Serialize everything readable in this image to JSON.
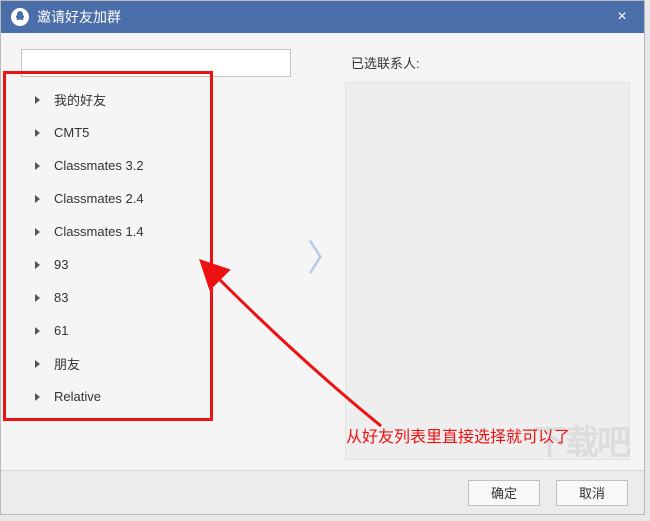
{
  "title": "邀请好友加群",
  "close_glyph": "×",
  "search": {
    "placeholder": ""
  },
  "groups": [
    {
      "label": "我的好友"
    },
    {
      "label": "CMT5"
    },
    {
      "label": "Classmates 3.2"
    },
    {
      "label": "Classmates  2.4"
    },
    {
      "label": "Classmates 1.4"
    },
    {
      "label": "93"
    },
    {
      "label": "83"
    },
    {
      "label": "61"
    },
    {
      "label": "朋友"
    },
    {
      "label": "Relative"
    }
  ],
  "transfer_glyph": "〉",
  "selected_label": "已选联系人:",
  "buttons": {
    "ok": "确定",
    "cancel": "取消"
  },
  "annotation": {
    "text": "从好友列表里直接选择就可以了"
  },
  "watermark": "下载吧"
}
